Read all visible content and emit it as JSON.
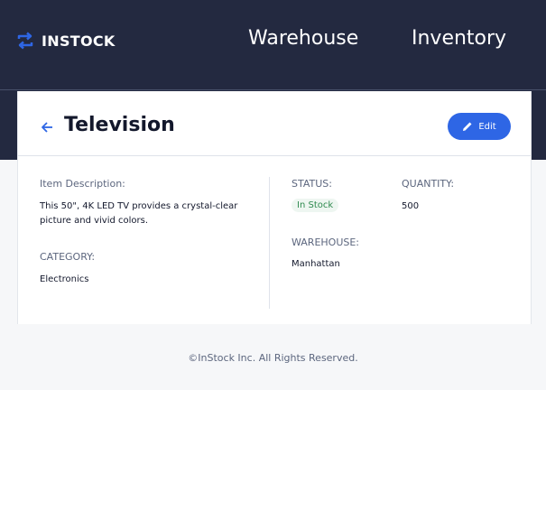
{
  "header": {
    "logo_text": "INSTOCK",
    "nav": {
      "warehouse": "Warehouse",
      "inventory": "Inventory"
    }
  },
  "item": {
    "title": "Television",
    "edit_label": "Edit",
    "description_label": "Item Description:",
    "description": "This 50\", 4K LED TV provides a crystal-clear picture and vivid colors.",
    "category_label": "CATEGORY:",
    "category": "Electronics",
    "status_label": "STATUS:",
    "status": "In Stock",
    "quantity_label": "QUANTITY:",
    "quantity": "500",
    "warehouse_label": "WAREHOUSE:",
    "warehouse": "Manhattan"
  },
  "footer": {
    "copyright": "©InStock Inc. All Rights Reserved."
  },
  "colors": {
    "header_bg": "#232940",
    "accent": "#2e66e5",
    "status_green": "#2f8a4f"
  },
  "icons": {
    "logo": "swap-arrows-icon",
    "back": "arrow-left-icon",
    "edit": "pencil-icon"
  }
}
